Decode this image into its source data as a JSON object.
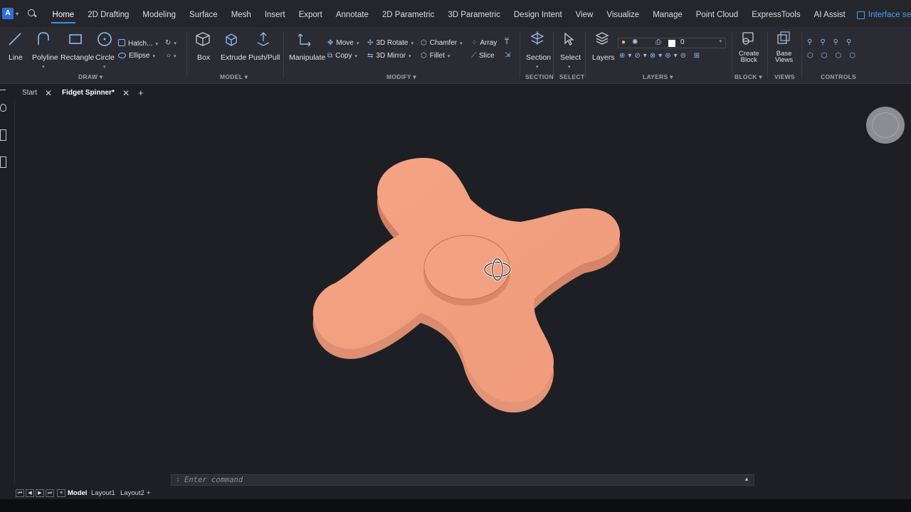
{
  "menu": {
    "tabs": [
      "Home",
      "2D Drafting",
      "Modeling",
      "Surface",
      "Mesh",
      "Insert",
      "Export",
      "Annotate",
      "2D Parametric",
      "3D Parametric",
      "Design Intent",
      "View",
      "Visualize",
      "Manage",
      "Point Cloud",
      "ExpressTools",
      "AI Assist"
    ],
    "active_tab": "Home",
    "interface_label": "Interface se"
  },
  "ribbon": {
    "draw": {
      "label": "DRAW",
      "line": "Line",
      "polyline": "Polyline",
      "rectangle": "Rectangle",
      "circle": "Circle",
      "hatch": "Hatch...",
      "ellipse": "Ellipse"
    },
    "model": {
      "label": "MODEL",
      "box": "Box",
      "extrude": "Extrude",
      "pushpull": "Push/Pull"
    },
    "modify": {
      "label": "MODIFY",
      "manipulate": "Manipulate",
      "move": "Move",
      "copy": "Copy",
      "rotate3d": "3D Rotate",
      "mirror3d": "3D Mirror",
      "chamfer": "Chamfer",
      "fillet": "Fillet",
      "array": "Array",
      "slice": "Slice"
    },
    "section": {
      "label": "SECTION",
      "button": "Section"
    },
    "select": {
      "label": "SELECT",
      "button": "Select"
    },
    "layers": {
      "label": "LAYERS",
      "button": "Layers",
      "current_layer": "0"
    },
    "block": {
      "label": "BLOCK",
      "create_line1": "Create",
      "create_line2": "Block"
    },
    "views": {
      "label": "VIEWS",
      "base_line1": "Base",
      "base_line2": "Views"
    },
    "controls": {
      "label": "CONTROLS"
    }
  },
  "doc_tabs": {
    "start": "Start",
    "active": "Fidget Spinner*"
  },
  "command": {
    "prompt": ":",
    "placeholder": "Enter command"
  },
  "layout_tabs": [
    "Model",
    "Layout1",
    "Layout2"
  ],
  "layout_active": "Model",
  "colors": {
    "accent": "#3a8ee6",
    "spinner": "#f09a7c",
    "background": "#1e1f24"
  }
}
